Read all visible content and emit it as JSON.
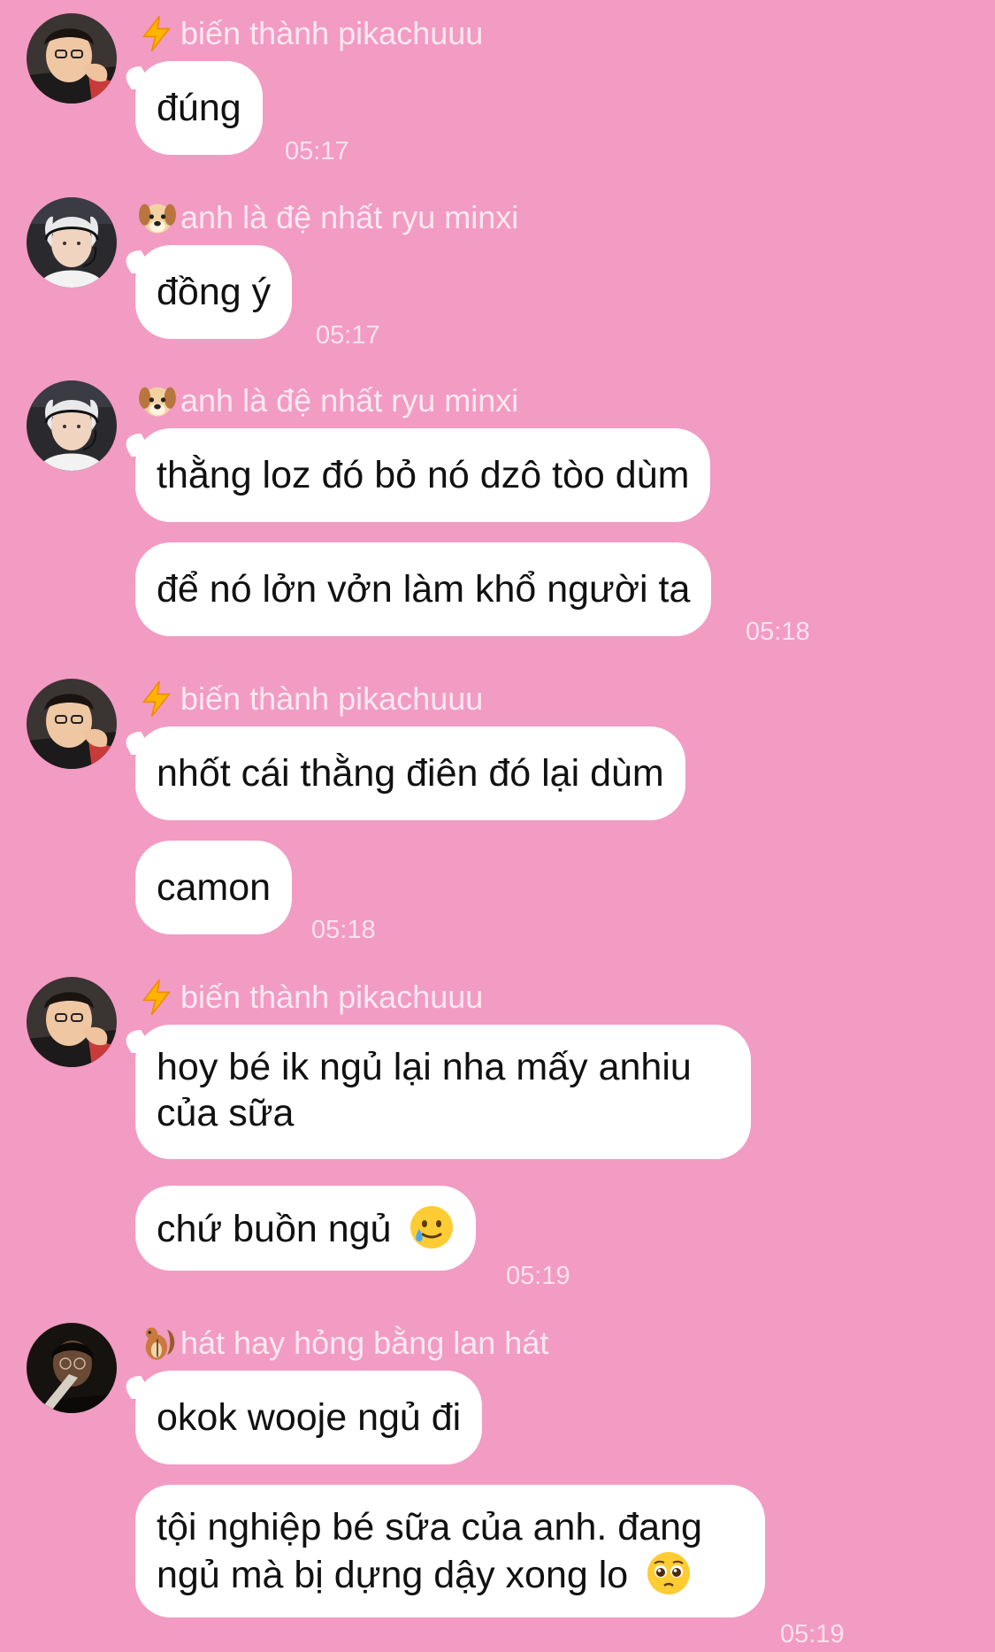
{
  "messages": [
    {
      "sender": "biến thành pikachuuu",
      "sender_emoji": "lightning-emoji",
      "avatar": "avatar-pikachu",
      "bubbles": [
        "đúng"
      ],
      "time": "05:17"
    },
    {
      "sender": "anh là đệ nhất ryu minxi",
      "sender_emoji": "dog-emoji",
      "avatar": "avatar-minxi",
      "bubbles": [
        "đồng ý"
      ],
      "time": "05:17"
    },
    {
      "sender": "anh là đệ nhất ryu minxi",
      "sender_emoji": "dog-emoji",
      "avatar": "avatar-minxi",
      "bubbles": [
        "thằng loz đó bỏ nó dzô tòo dùm",
        "để nó lởn vởn làm khổ người ta"
      ],
      "time": "05:18"
    },
    {
      "sender": "biến thành pikachuuu",
      "sender_emoji": "lightning-emoji",
      "avatar": "avatar-pikachu",
      "bubbles": [
        "nhốt cái thằng điên đó lại dùm",
        "camon"
      ],
      "time": "05:18"
    },
    {
      "sender": "biến thành pikachuuu",
      "sender_emoji": "lightning-emoji",
      "avatar": "avatar-pikachu",
      "bubbles": [
        "hoy bé ik ngủ lại nha mấy anhiu",
        "của sữa",
        "chứ buồn ngủ"
      ],
      "time": "05:19"
    },
    {
      "sender": "hát hay hỏng bằng lan hát",
      "sender_emoji": "chipmunk-emoji",
      "avatar": "avatar-lan",
      "bubbles": [
        "okok wooje ngủ đi",
        "tội nghiệp bé sữa của anh. đang",
        "ngủ mà bị dựng dậy xong lo"
      ],
      "time": "05:19"
    }
  ]
}
